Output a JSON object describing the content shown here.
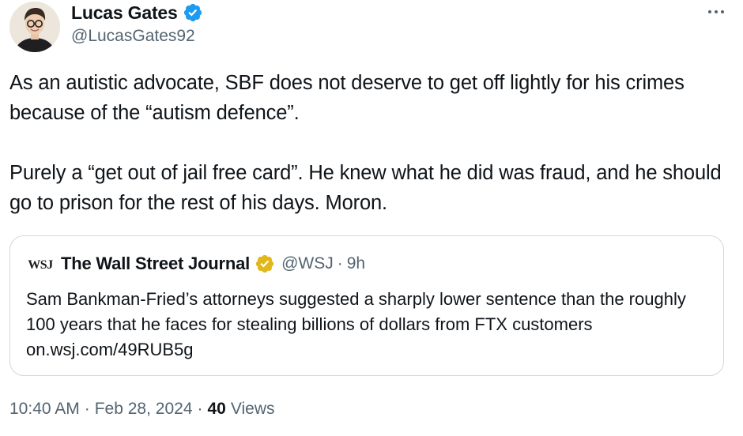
{
  "author": {
    "display_name": "Lucas Gates",
    "handle": "@LucasGates92",
    "verified_badge_color": "#1d9bf0",
    "avatar_icon": "user-avatar"
  },
  "more_icon": "more-horizontal-icon",
  "tweet": {
    "paragraphs": [
      "As an autistic advocate, SBF does not deserve to get off lightly for his crimes because of the “autism defence”.",
      "Purely a “get out of jail free card”. He knew what he did was fraud, and he should go to prison for the rest of his days. Moron."
    ]
  },
  "quote": {
    "logo_text": "WSJ",
    "display_name": "The Wall Street Journal",
    "badge_color": "#e2b719",
    "handle": "@WSJ",
    "separator": "·",
    "time": "9h",
    "text": "Sam Bankman-Fried’s attorneys suggested a sharply lower sentence than the roughly 100 years that he faces for stealing billions of dollars from FTX customers ",
    "link_text": "on.wsj.com/49RUB5g"
  },
  "meta": {
    "time": "10:40 AM",
    "separator": "·",
    "date": "Feb 28, 2024",
    "views_count": "40",
    "views_label": "Views"
  },
  "colors": {
    "text_primary": "#0f1419",
    "text_secondary": "#536471",
    "border": "#cfd9de"
  }
}
